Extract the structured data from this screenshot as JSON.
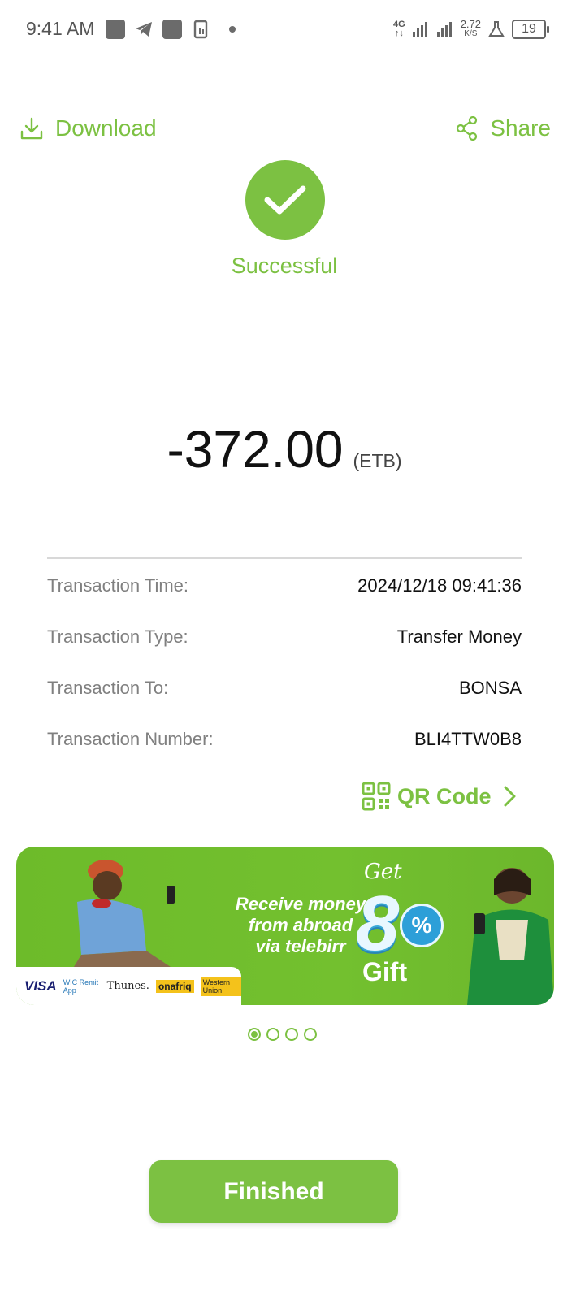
{
  "status_bar": {
    "time": "9:41 AM",
    "network": "4G",
    "speed": "2.72",
    "speed_unit": "K/S",
    "battery": "19"
  },
  "header": {
    "download_label": "Download",
    "share_label": "Share"
  },
  "status": {
    "label": "Successful"
  },
  "amount": {
    "value": "-372.00",
    "currency": "(ETB)"
  },
  "details": [
    {
      "label": "Transaction Time:",
      "value": "2024/12/18 09:41:36"
    },
    {
      "label": "Transaction Type:",
      "value": "Transfer Money"
    },
    {
      "label": "Transaction To:",
      "value": "BONSA"
    },
    {
      "label": "Transaction Number:",
      "value": "BLI4TTW0B8"
    }
  ],
  "qr": {
    "label": "QR Code"
  },
  "banner": {
    "text_line1": "Receive money",
    "text_line2": "from abroad",
    "text_line3": "via telebirr",
    "get": "Get",
    "number": "8",
    "percent": "%",
    "gift": "Gift",
    "partners": [
      "VISA",
      "WIC Remit App",
      "Thunes.",
      "onafriq",
      "Western Union"
    ]
  },
  "pager": {
    "count": 4,
    "active_index": 0
  },
  "footer": {
    "finished_label": "Finished"
  },
  "colors": {
    "accent": "#7cc142"
  }
}
